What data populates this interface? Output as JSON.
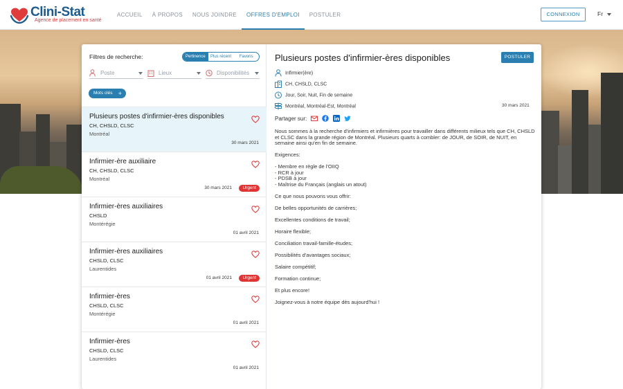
{
  "brand": {
    "name": "Clini-Stat",
    "tagline": "Agence de placement en santé"
  },
  "nav": {
    "links": [
      "ACCUEIL",
      "À PROPOS",
      "NOUS JOINDRE",
      "OFFRES D'EMPLOI",
      "POSTULER"
    ],
    "active": "OFFRES D'EMPLOI",
    "login_label": "CONNEXION",
    "language": "Fr"
  },
  "filters": {
    "title": "Filtres de recherche:",
    "sort_options": [
      "Pertinence",
      "Plus récent",
      "Favoris"
    ],
    "sort_active": "Pertinence",
    "poste_label": "Poste",
    "lieux_label": "Lieux",
    "dispo_label": "Disponibilités",
    "keywords_label": "Mots clés"
  },
  "jobs": [
    {
      "title": "Plusieurs postes d'infirmier-ères disponibles",
      "establishments": "CH, CHSLD, CLSC",
      "location": "Montréal",
      "date": "30 mars 2021",
      "urgent": "",
      "selected": true
    },
    {
      "title": "Infirmier-ère auxiliaire",
      "establishments": "CH, CHSLD, CLSC",
      "location": "Montréal",
      "date": "30 mars 2021",
      "urgent": "Urgent"
    },
    {
      "title": "Infirmier-ères auxiliaires",
      "establishments": "CHSLD",
      "location": "Montérégie",
      "date": "01 avril 2021",
      "urgent": ""
    },
    {
      "title": "Infirmier-ères auxiliaires",
      "establishments": "CHSLD, CLSC",
      "location": "Laurentides",
      "date": "01 avril 2021",
      "urgent": "Urgent"
    },
    {
      "title": "Infirmier-ères",
      "establishments": "CHSLD, CLSC",
      "location": "Montérégie",
      "date": "01 avril 2021",
      "urgent": ""
    },
    {
      "title": "Infirmier-ères",
      "establishments": "CHSLD, CLSC",
      "location": "Laurentides",
      "date": "01 avril 2021",
      "urgent": ""
    }
  ],
  "detail": {
    "title": "Plusieurs postes d'infirmier-ères disponibles",
    "apply_label": "POSTULER",
    "role": "Infirmier(ère)",
    "establishments": "CH, CHSLD, CLSC",
    "schedule": "Jour, Soir, Nuit, Fin de semaine",
    "regions": "Montréal, Montréal-Est, Montréal",
    "date": "30 mars 2021",
    "share_label": "Partager sur:",
    "intro": "Nous sommes à la recherche d'infirmiers et infirmières pour travailler dans différents milieux tels que CH, CHSLD et CLSC dans la grande région de Montréal. Plusieurs quarts à combler: de JOUR, de SOIR, de NUIT, en semaine ainsi qu'en fin de semaine.",
    "requirements_title": "Exigences:",
    "requirements": [
      "Membre en règle de l'OIIQ",
      "RCR à jour",
      "PDSB à jour",
      "Maîtrise du Français (anglais un atout)"
    ],
    "offer_title": "Ce que nous pouvons vous offrir:",
    "offers": [
      "De belles opportunités de carrières;",
      "Excellentes conditions de travail;",
      "Horaire flexible;",
      "Conciliation travail-famille-études;",
      "Possibilités d'avantages sociaux;",
      "Salaire compétitif;",
      "Formation continue;",
      "Et plus encore!"
    ],
    "closing": "Joignez-vous à notre équipe dès aujourd'hui !"
  },
  "colors": {
    "accent": "#2a7fb0",
    "urgent": "#e03434",
    "selected_bg": "#e7f4f9",
    "icon": "#2a7fb0"
  }
}
